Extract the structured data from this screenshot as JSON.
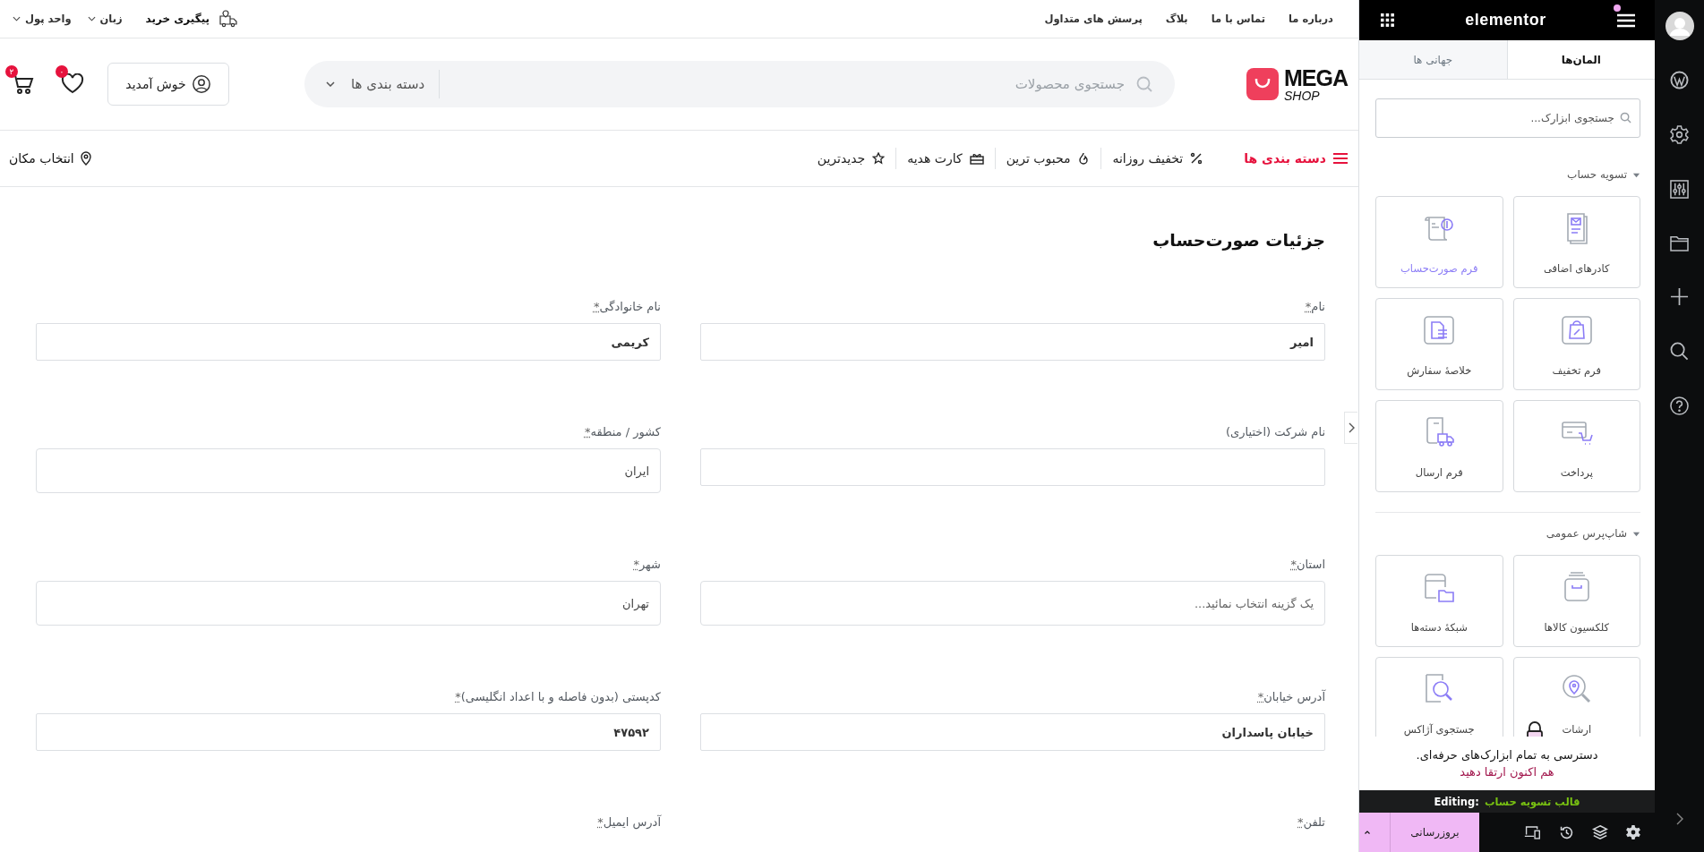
{
  "top_bar": {
    "links": [
      "درباره ما",
      "تماس با ما",
      "بلاگ",
      "پرسش های متداول"
    ],
    "track_order": "پیگیری خرید",
    "menus": [
      "زبان",
      "واحد پول"
    ]
  },
  "header": {
    "logo": {
      "title": "MEGA",
      "subtitle": "SHOP"
    },
    "search": {
      "placeholder": "جستجوی محصولات",
      "category": "دسته بندی ها"
    },
    "account": "خوش آمدید",
    "wishlist_count": "۰",
    "cart_count": "۲"
  },
  "nav": {
    "categories": "دسته بندی ها",
    "items": [
      {
        "label": "تخفیف روزانه"
      },
      {
        "label": "محبوب ترین"
      },
      {
        "label": "کارت هدیه"
      },
      {
        "label": "جدیدترین"
      }
    ],
    "location": "انتخاب مکان"
  },
  "checkout": {
    "title": "جزئیات صورت‌حساب",
    "fields": [
      {
        "label": "نام",
        "mark": "*",
        "kind": "text",
        "value": "امیر"
      },
      {
        "label": "نام خانوادگی",
        "mark": "*",
        "kind": "text",
        "value": "کریمی"
      },
      {
        "label": "نام شرکت (اختیاری)",
        "kind": "text"
      },
      {
        "label": "کشور / منطقه",
        "mark": "*",
        "kind": "select",
        "value": "ایران"
      },
      {
        "label": "استان",
        "mark": "*",
        "kind": "select",
        "placeholder": "یک گزینه انتخاب نمائید..."
      },
      {
        "label": "شهر",
        "mark": "*",
        "kind": "select",
        "value": "تهران"
      },
      {
        "label": "آدرس خیابان",
        "mark": "*",
        "kind": "text",
        "value": "خیابان پاسداران"
      },
      {
        "label": "کدپستی (بدون فاصله و با اعداد انگلیسی)",
        "mark": "*",
        "kind": "text",
        "value": "۴۷۵۹۲"
      },
      {
        "label": "تلفن",
        "mark": "*"
      },
      {
        "label": "آدرس ایمیل",
        "mark": "*"
      }
    ]
  },
  "editor": {
    "brand": "elementor",
    "notification": true,
    "tabs": [
      {
        "label": "المان‌ها",
        "selected": true
      },
      {
        "label": "جهانی ها",
        "selected": false
      }
    ],
    "search": {
      "placeholder": "جستجوی ابزارک..."
    },
    "sections": [
      {
        "title": "تسویه حساب",
        "expanded": true,
        "widgets": [
          {
            "label": "کادرهای اضافی",
            "selected": false,
            "locked": false
          },
          {
            "label": "فرم صورت‌حساب",
            "selected": true,
            "locked": false
          },
          {
            "label": "فرم تخفیف",
            "selected": false,
            "locked": false
          },
          {
            "label": "خلاصهٔ سفارش",
            "selected": false,
            "locked": false
          },
          {
            "label": "پرداخت",
            "selected": false,
            "locked": false
          },
          {
            "label": "فرم ارسال",
            "selected": false,
            "locked": false
          }
        ]
      },
      {
        "title": "شاپ‌پرس عمومی",
        "expanded": true,
        "widgets": [
          {
            "label": "کلکسیون کالاها",
            "selected": false,
            "locked": false
          },
          {
            "label": "شبکهٔ دسته‌ها",
            "selected": false,
            "locked": false
          },
          {
            "label": "ارشات",
            "selected": false,
            "locked": true
          },
          {
            "label": "جستجوی آژاکس",
            "selected": false,
            "locked": false
          }
        ]
      }
    ],
    "promo": {
      "text": "دسترسی به تمام ابزارک‌های حرفه‌ای.",
      "link": "هم اکنون ارتقا دهید"
    },
    "editing": {
      "label": "Editing:",
      "template": "قالب تسویه حساب"
    },
    "publish": "بروزرسانی"
  }
}
